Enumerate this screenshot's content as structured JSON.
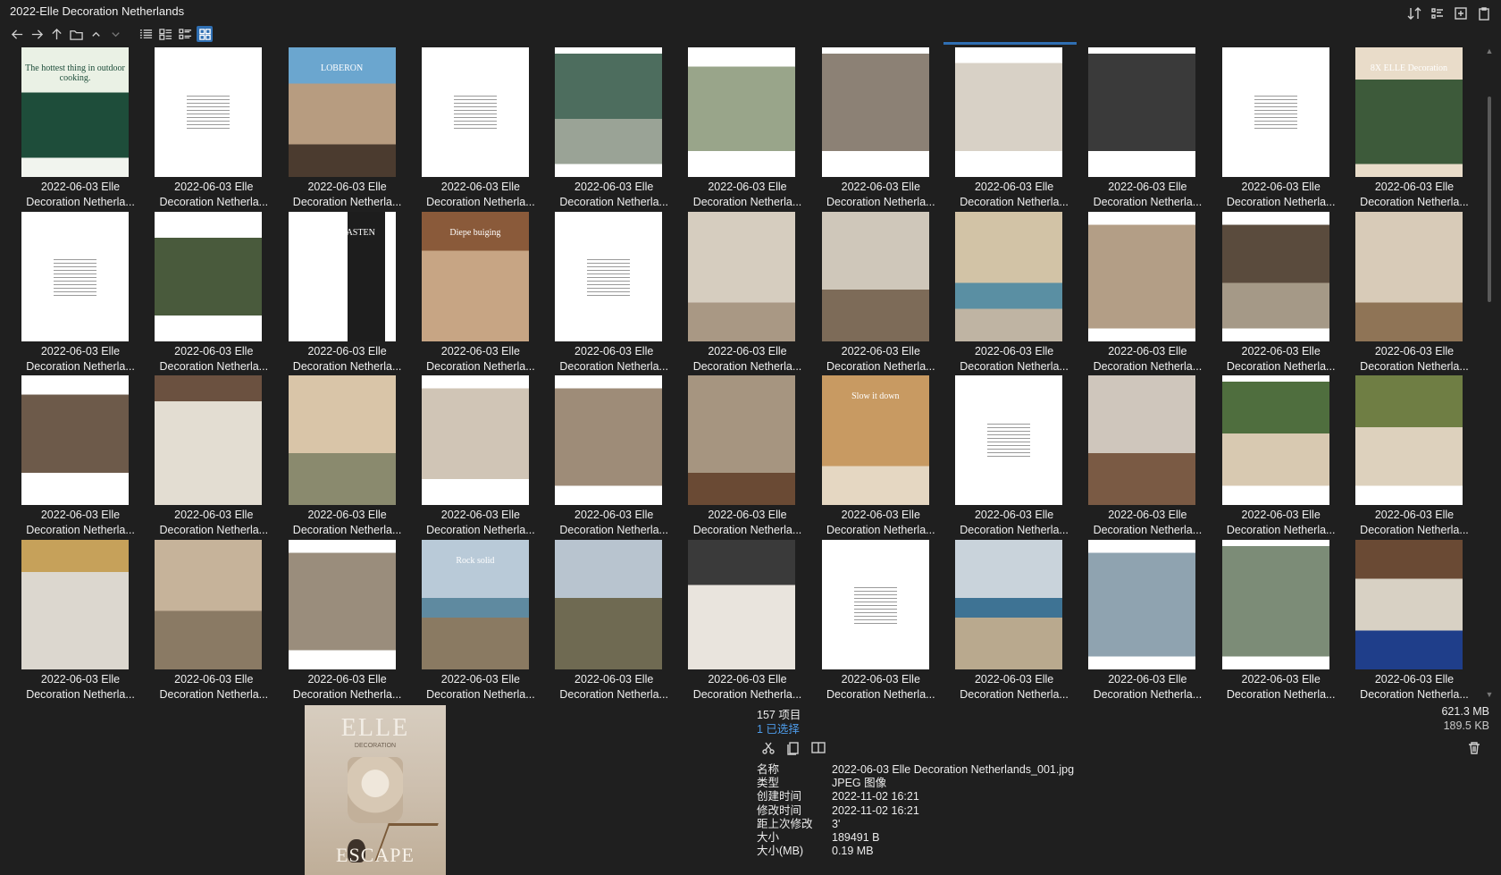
{
  "window": {
    "title": "2022-Elle Decoration Netherlands"
  },
  "toolbar": {
    "back_icon": "arrow-left-icon",
    "forward_icon": "arrow-right-icon",
    "up_icon": "arrow-up-icon",
    "folder_icon": "folder-icon",
    "view_modes": [
      "list-view",
      "detail-view",
      "tree-view",
      "thumbnail-view"
    ],
    "active_view": "thumbnail-view"
  },
  "header_actions": [
    "sort-icon",
    "checklist-icon",
    "add-panel-icon",
    "clipboard-icon"
  ],
  "thumbnails": {
    "label_line1": "2022-06-03 Elle",
    "label_line2": "Decoration Netherla...",
    "items": [
      {
        "caption": "The hottest thing in outdoor cooking."
      },
      {
        "caption": ""
      },
      {
        "caption": "LOBERON"
      },
      {
        "caption": ""
      },
      {
        "caption": ""
      },
      {
        "caption": ""
      },
      {
        "caption": ""
      },
      {
        "caption": ""
      },
      {
        "caption": ""
      },
      {
        "caption": ""
      },
      {
        "caption": "8X ELLE Decoration"
      },
      {
        "caption": ""
      },
      {
        "caption": ""
      },
      {
        "caption": "ZOMERGASTEN"
      },
      {
        "caption": "Diepe buiging"
      },
      {
        "caption": ""
      },
      {
        "caption": ""
      },
      {
        "caption": ""
      },
      {
        "caption": ""
      },
      {
        "caption": ""
      },
      {
        "caption": ""
      },
      {
        "caption": ""
      },
      {
        "caption": ""
      },
      {
        "caption": ""
      },
      {
        "caption": ""
      },
      {
        "caption": ""
      },
      {
        "caption": ""
      },
      {
        "caption": ""
      },
      {
        "caption": "Slow it down"
      },
      {
        "caption": ""
      },
      {
        "caption": ""
      },
      {
        "caption": ""
      },
      {
        "caption": ""
      },
      {
        "caption": ""
      },
      {
        "caption": ""
      },
      {
        "caption": ""
      },
      {
        "caption": "Rock solid"
      },
      {
        "caption": ""
      },
      {
        "caption": ""
      },
      {
        "caption": ""
      },
      {
        "caption": ""
      },
      {
        "caption": ""
      },
      {
        "caption": ""
      },
      {
        "caption": ""
      }
    ]
  },
  "preview": {
    "logo": "ELLE",
    "subtitle": "DECORATION",
    "cover_title": "ESCAPE"
  },
  "details": {
    "count": "157 项目",
    "selected": "1 已选择",
    "total_size": "621.3 MB",
    "selected_size": "189.5 KB",
    "action_icons": [
      "scissors-icon",
      "copy-icon",
      "compare-icon"
    ],
    "props": [
      {
        "k": "名称",
        "v": "2022-06-03 Elle Decoration Netherlands_001.jpg"
      },
      {
        "k": "类型",
        "v": "JPEG 图像"
      },
      {
        "k": "创建时间",
        "v": "2022-11-02  16:21"
      },
      {
        "k": "修改时间",
        "v": "2022-11-02  16:21"
      },
      {
        "k": "距上次修改",
        "v": "3'"
      },
      {
        "k": "大小",
        "v": "189491 B"
      },
      {
        "k": "大小(MB)",
        "v": "0.19 MB"
      }
    ]
  },
  "colors": {
    "background": "#1f1f1f",
    "accent": "#2f6fb3",
    "selected_text": "#4d9be8"
  }
}
